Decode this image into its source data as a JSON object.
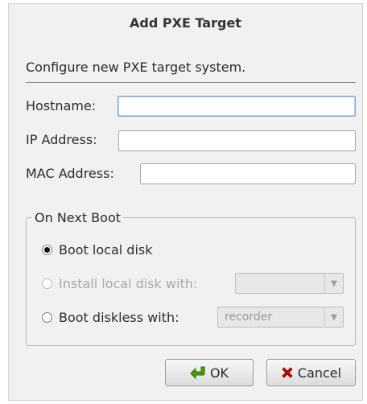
{
  "dialog": {
    "title": "Add PXE Target",
    "subtitle": "Configure new PXE target system."
  },
  "form": {
    "hostname_label": "Hostname:",
    "hostname_value": "",
    "ip_label": "IP Address:",
    "ip_value": "",
    "mac_label": "MAC Address:",
    "mac_value": ""
  },
  "boot_group": {
    "title": "On Next Boot",
    "options": [
      {
        "label": "Boot local disk",
        "checked": true,
        "enabled": true
      },
      {
        "label": "Install local disk with:",
        "checked": false,
        "enabled": false,
        "combo_value": ""
      },
      {
        "label": "Boot diskless with:",
        "checked": false,
        "enabled": true,
        "combo_value": "recorder"
      }
    ]
  },
  "buttons": {
    "ok_label": "OK",
    "cancel_label": "Cancel"
  },
  "icons": {
    "ok": "green-arrow-icon",
    "cancel": "red-x-icon",
    "combo": "chevron-down-icon"
  }
}
